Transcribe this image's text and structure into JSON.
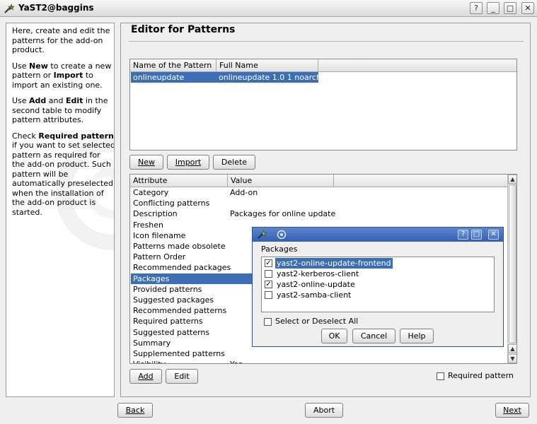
{
  "window": {
    "title": "YaST2@baggins"
  },
  "help": {
    "p1": "Here, create and edit the patterns for the add-on product.",
    "p2_pre": "Use ",
    "p2_new": "New",
    "p2_mid": " to create a new pattern or ",
    "p2_import": "Import",
    "p2_post": " to import an existing one.",
    "p3_pre": "Use ",
    "p3_add": "Add",
    "p3_and": " and ",
    "p3_edit": "Edit",
    "p3_post": " in the second table to modify pattern attributes.",
    "p4_pre": "Check ",
    "p4_req": "Required pattern",
    "p4_post": " if you want to set selected pattern as required for the add-on product. Such pattern will be automatically preselected when the installation of the add-on product is started."
  },
  "editor": {
    "title": "Editor for Patterns"
  },
  "patterns_table": {
    "headers": [
      "Name of the Pattern",
      "Full Name"
    ],
    "rows": [
      {
        "name": "onlineupdate",
        "full_name": "onlineupdate 1.0 1 noarch"
      }
    ]
  },
  "pattern_buttons": {
    "new": "New",
    "import": "Import",
    "delete": "Delete"
  },
  "attributes_table": {
    "headers": [
      "Attribute",
      "Value"
    ],
    "rows": [
      {
        "attribute": "Category",
        "value": "Add-on"
      },
      {
        "attribute": "Conflicting patterns",
        "value": ""
      },
      {
        "attribute": "Description",
        "value": "Packages for online update"
      },
      {
        "attribute": "Freshen",
        "value": ""
      },
      {
        "attribute": "Icon filename",
        "value": ""
      },
      {
        "attribute": "Patterns made obsolete",
        "value": ""
      },
      {
        "attribute": "Pattern Order",
        "value": ""
      },
      {
        "attribute": "Recommended packages",
        "value": ""
      },
      {
        "attribute": "Packages",
        "value": ""
      },
      {
        "attribute": "Provided patterns",
        "value": ""
      },
      {
        "attribute": "Suggested packages",
        "value": ""
      },
      {
        "attribute": "Recommended patterns",
        "value": ""
      },
      {
        "attribute": "Required patterns",
        "value": ""
      },
      {
        "attribute": "Suggested patterns",
        "value": ""
      },
      {
        "attribute": "Summary",
        "value": ""
      },
      {
        "attribute": "Supplemented patterns",
        "value": ""
      },
      {
        "attribute": "Visibility",
        "value": "Yes"
      }
    ],
    "selected_index": 8
  },
  "attribute_buttons": {
    "add": "Add",
    "edit": "Edit"
  },
  "required_pattern": {
    "label": "Required pattern",
    "checked": false
  },
  "nav": {
    "back": "Back",
    "abort": "Abort",
    "next": "Next"
  },
  "dialog": {
    "packages_label": "Packages",
    "packages": [
      {
        "name": "yast2-online-update-frontend",
        "checked": true,
        "selected": true
      },
      {
        "name": "yast2-kerberos-client",
        "checked": false,
        "selected": false
      },
      {
        "name": "yast2-online-update",
        "checked": true,
        "selected": false
      },
      {
        "name": "yast2-samba-client",
        "checked": false,
        "selected": false
      }
    ],
    "select_all": {
      "label": "Select or Deselect All",
      "checked": false
    },
    "buttons": {
      "ok": "OK",
      "cancel": "Cancel",
      "help": "Help"
    },
    "title_buttons": {
      "help": "?",
      "maximize": "□",
      "close": "✕"
    }
  },
  "window_buttons": {
    "help": "?",
    "minimize": "_",
    "maximize": "□",
    "close": "✕"
  }
}
